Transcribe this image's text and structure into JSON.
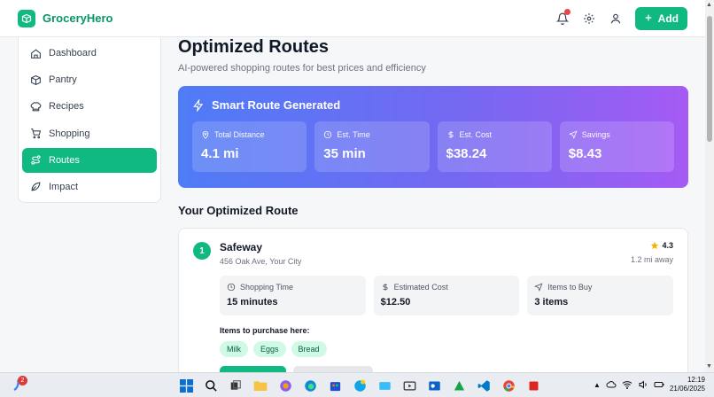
{
  "app": {
    "name": "GroceryHero"
  },
  "header": {
    "add_label": "Add"
  },
  "sidebar": {
    "items": [
      {
        "label": "Dashboard",
        "icon": "home-icon",
        "active": false
      },
      {
        "label": "Pantry",
        "icon": "box-icon",
        "active": false
      },
      {
        "label": "Recipes",
        "icon": "chef-hat-icon",
        "active": false
      },
      {
        "label": "Shopping",
        "icon": "cart-icon",
        "active": false
      },
      {
        "label": "Routes",
        "icon": "route-icon",
        "active": true
      },
      {
        "label": "Impact",
        "icon": "leaf-icon",
        "active": false
      }
    ]
  },
  "page": {
    "title": "Optimized Routes",
    "subtitle": "AI-powered shopping routes for best prices and efficiency"
  },
  "smart_route": {
    "title": "Smart Route Generated",
    "stats": [
      {
        "label": "Total Distance",
        "value": "4.1 mi",
        "icon": "map-pin-icon"
      },
      {
        "label": "Est. Time",
        "value": "35 min",
        "icon": "clock-icon"
      },
      {
        "label": "Est. Cost",
        "value": "$38.24",
        "icon": "dollar-icon"
      },
      {
        "label": "Savings",
        "value": "$8.43",
        "icon": "navigation-icon"
      }
    ]
  },
  "route": {
    "section_title": "Your Optimized Route",
    "stops": [
      {
        "number": "1",
        "name": "Safeway",
        "address": "456 Oak Ave, Your City",
        "rating": "4.3",
        "distance": "1.2 mi away",
        "details": [
          {
            "label": "Shopping Time",
            "value": "15 minutes",
            "icon": "clock-icon"
          },
          {
            "label": "Estimated Cost",
            "value": "$12.50",
            "icon": "dollar-icon"
          },
          {
            "label": "Items to Buy",
            "value": "3 items",
            "icon": "navigation-icon"
          }
        ],
        "items_title": "Items to purchase here:",
        "items": [
          "Milk",
          "Eggs",
          "Bread"
        ]
      }
    ]
  },
  "taskbar": {
    "notification_count": "2",
    "time": "12:19",
    "date": "21/06/2025"
  },
  "colors": {
    "brand": "#10b981",
    "gradient_start": "#4f7cf6",
    "gradient_end": "#a55bf4"
  }
}
